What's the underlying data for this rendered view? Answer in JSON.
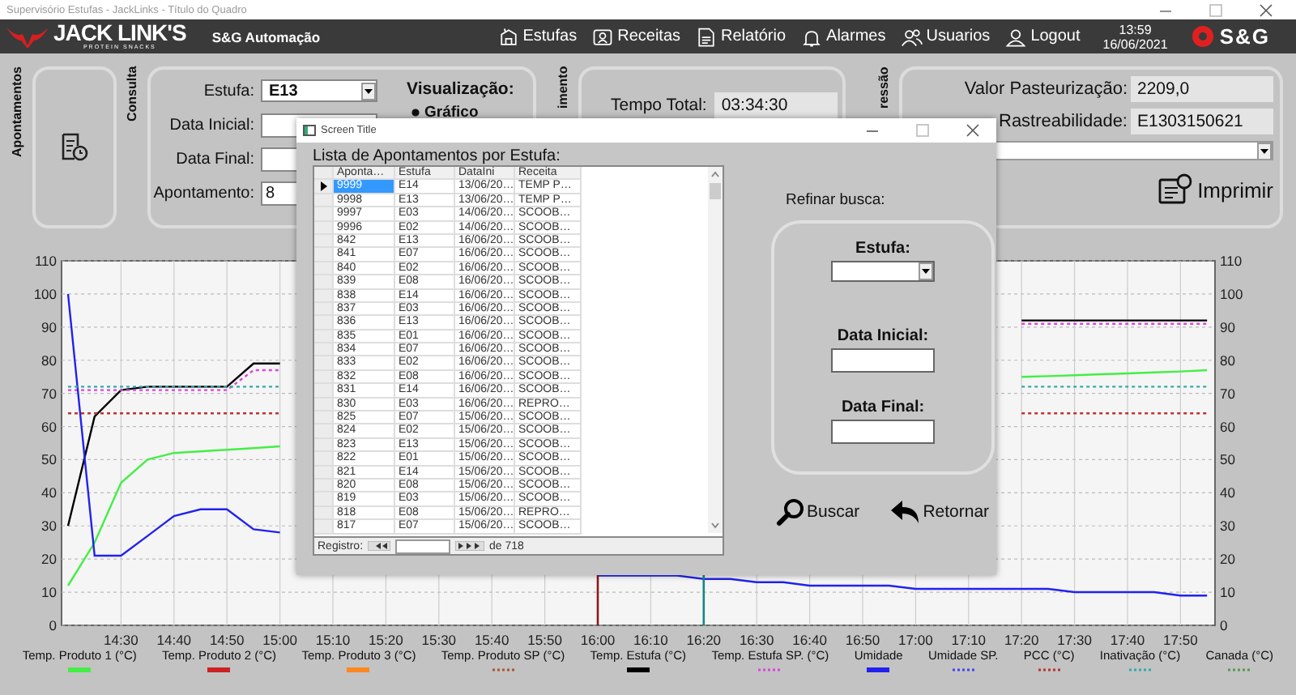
{
  "window": {
    "title": "Supervisório Estufas - JackLinks - Título do Quadro"
  },
  "header": {
    "brand": "JACK LINK'S",
    "brand_tagline": "PROTEIN SNACKS",
    "company": "S&G Automação",
    "nav": [
      {
        "label": "Estufas"
      },
      {
        "label": "Receitas"
      },
      {
        "label": "Relatório"
      },
      {
        "label": "Alarmes"
      },
      {
        "label": "Usuarios"
      },
      {
        "label": "Logout"
      }
    ],
    "time": "13:59",
    "date": "16/06/2021",
    "partner_logo": "S&G"
  },
  "panels": {
    "apontamentos": {
      "label": "Apontamentos"
    },
    "consulta": {
      "label": "Consulta",
      "estufa_label": "Estufa:",
      "estufa_value": "E13",
      "data_inicial_label": "Data Inicial:",
      "data_final_label": "Data Final:",
      "apontamento_label": "Apontamento:",
      "apontamento_value": "8",
      "visualizacao_label": "Visualização:",
      "visualizacao_option": {
        "label": "Gráfico",
        "selected": true
      }
    },
    "tempo": {
      "label": "imento",
      "tempo_total_label": "Tempo Total:",
      "tempo_total_value": "03:34:30"
    },
    "impressao": {
      "label": "ressão",
      "valor_label": "Valor Pasteurização:",
      "valor_value": "2209,0",
      "rastreabilidade_label": "Rastreabilidade:",
      "rastreabilidade_value": "E1303150621",
      "print_button": "Imprimir"
    }
  },
  "chart": {
    "chart_data": {
      "type": "line",
      "ylim": [
        0,
        110
      ],
      "categories": [
        null,
        null,
        "14:30",
        null,
        "14:40",
        null,
        "14:50",
        null,
        "15:00",
        null,
        "15:10",
        null,
        "15:20",
        null,
        "15:30",
        null,
        "15:40",
        null,
        "15:50",
        null,
        "16:00",
        null,
        "16:10",
        null,
        "16:20",
        null,
        "16:30",
        null,
        "16:40",
        null,
        "16:50",
        null,
        "17:00",
        null,
        "17:10",
        null,
        "17:20",
        null,
        "17:30",
        null,
        "17:40",
        null,
        "17:50",
        null
      ],
      "yticks": [
        0,
        10,
        20,
        30,
        40,
        50,
        60,
        70,
        80,
        90,
        100,
        110
      ],
      "series": [
        {
          "name": "Temp. Produto 1 (°C)",
          "color": "#44ee44",
          "line_style": "solid",
          "values": [
            12,
            25,
            43,
            50,
            52,
            52.5,
            53,
            53.5,
            54,
            null,
            null,
            null,
            null,
            null,
            null,
            null,
            null,
            null,
            null,
            null,
            null,
            null,
            null,
            null,
            null,
            null,
            null,
            null,
            null,
            null,
            null,
            null,
            null,
            null,
            null,
            null,
            75,
            75.2,
            75.5,
            75.8,
            76,
            76.3,
            76.6,
            77
          ]
        },
        {
          "name": "Temp. Produto 2 (°C)",
          "color": "#cc2222",
          "line_style": "solid",
          "values": [
            null,
            null,
            null,
            null,
            null,
            null,
            null,
            null,
            null,
            null,
            null,
            null,
            null,
            null,
            null,
            null,
            null,
            null,
            null,
            null,
            null,
            null,
            null,
            null,
            null,
            null,
            null,
            null,
            null,
            null,
            null,
            null,
            null,
            null,
            null,
            null,
            null,
            null,
            null,
            null,
            null,
            null,
            null,
            null
          ]
        },
        {
          "name": "Temp. Produto 3 (°C)",
          "color": "#ff8822",
          "line_style": "solid",
          "values": [
            null,
            null,
            null,
            null,
            null,
            null,
            null,
            null,
            null,
            null,
            null,
            null,
            null,
            null,
            null,
            null,
            null,
            null,
            null,
            null,
            null,
            null,
            null,
            null,
            null,
            null,
            null,
            null,
            null,
            null,
            null,
            null,
            null,
            null,
            null,
            null,
            null,
            null,
            null,
            null,
            null,
            null,
            null,
            null
          ]
        },
        {
          "name": "Temp. Produto SP (°C)",
          "color": "#aa5533",
          "line_style": "dotted",
          "values": [
            null,
            null,
            null,
            null,
            null,
            null,
            null,
            null,
            null,
            null,
            null,
            null,
            null,
            null,
            null,
            null,
            null,
            null,
            null,
            null,
            null,
            null,
            null,
            null,
            null,
            null,
            null,
            null,
            null,
            null,
            null,
            null,
            null,
            null,
            null,
            null,
            null,
            null,
            null,
            null,
            null,
            null,
            null,
            null
          ]
        },
        {
          "name": "Temp. Estufa (°C)",
          "color": "#000000",
          "line_style": "solid",
          "values": [
            30,
            63,
            71,
            72,
            72,
            72,
            72,
            79,
            79,
            null,
            null,
            null,
            null,
            null,
            null,
            null,
            null,
            null,
            null,
            null,
            null,
            null,
            null,
            null,
            null,
            null,
            null,
            null,
            null,
            null,
            null,
            null,
            null,
            null,
            null,
            null,
            92,
            92,
            92,
            92,
            92,
            92,
            92,
            92
          ]
        },
        {
          "name": "Temp. Estufa SP. (°C)",
          "color": "#dd44dd",
          "line_style": "dotted",
          "values": [
            71,
            71,
            71,
            71,
            71,
            71,
            71,
            77,
            77,
            null,
            null,
            null,
            null,
            null,
            null,
            null,
            null,
            null,
            null,
            null,
            null,
            null,
            null,
            null,
            null,
            null,
            null,
            null,
            null,
            null,
            null,
            null,
            null,
            null,
            null,
            null,
            91,
            91,
            91,
            91,
            91,
            91,
            91,
            91
          ]
        },
        {
          "name": "Umidade",
          "color": "#2222ee",
          "line_style": "solid",
          "values": [
            100,
            21,
            21,
            27,
            33,
            35,
            35,
            29,
            28,
            null,
            null,
            null,
            null,
            null,
            null,
            null,
            null,
            null,
            null,
            null,
            15,
            15,
            15,
            15,
            14,
            14,
            13,
            13,
            12,
            12,
            12,
            12,
            11,
            11,
            11,
            11,
            11,
            11,
            10,
            10,
            10,
            10,
            9,
            9
          ]
        },
        {
          "name": "Umidade SP.",
          "color": "#4444ee",
          "line_style": "dotted",
          "values": [
            null,
            null,
            null,
            null,
            null,
            null,
            null,
            null,
            null,
            null,
            null,
            null,
            null,
            null,
            null,
            null,
            null,
            null,
            null,
            null,
            null,
            null,
            null,
            null,
            null,
            null,
            null,
            null,
            null,
            null,
            null,
            null,
            null,
            null,
            null,
            null,
            null,
            null,
            null,
            null,
            null,
            null,
            null,
            null
          ]
        },
        {
          "name": "PCC (°C)",
          "color": "#bb3333",
          "line_style": "dotted",
          "values": [
            64,
            64,
            64,
            64,
            64,
            64,
            64,
            64,
            64,
            null,
            null,
            null,
            null,
            null,
            null,
            null,
            null,
            null,
            null,
            null,
            null,
            null,
            null,
            null,
            null,
            null,
            null,
            null,
            null,
            null,
            null,
            null,
            null,
            null,
            null,
            null,
            64,
            64,
            64,
            64,
            64,
            64,
            64,
            64
          ]
        },
        {
          "name": "Inativação (°C)",
          "color": "#33aaaa",
          "line_style": "dotted",
          "values": [
            72,
            72,
            72,
            72,
            72,
            72,
            72,
            72,
            72,
            null,
            null,
            null,
            null,
            null,
            null,
            null,
            null,
            null,
            null,
            null,
            null,
            null,
            null,
            null,
            null,
            null,
            null,
            null,
            null,
            null,
            null,
            null,
            null,
            null,
            null,
            null,
            72,
            72,
            72,
            72,
            72,
            72,
            72,
            72
          ]
        },
        {
          "name": "Canada (°C)",
          "color": "#559955",
          "line_style": "dotted",
          "values": [
            null,
            null,
            null,
            null,
            null,
            null,
            null,
            null,
            null,
            null,
            null,
            null,
            null,
            null,
            null,
            null,
            null,
            null,
            null,
            null,
            null,
            null,
            null,
            null,
            null,
            null,
            null,
            null,
            null,
            null,
            null,
            null,
            null,
            null,
            null,
            null,
            null,
            null,
            null,
            null,
            null,
            null,
            null,
            null
          ]
        }
      ],
      "grid": true,
      "ref_lines": [
        {
          "axis": "x",
          "value": "16:00",
          "color": "#8b1a1a"
        },
        {
          "axis": "x",
          "value": "16:20",
          "color": "#118888"
        }
      ]
    },
    "right_axis_labels": [
      "110",
      "100",
      "90",
      "80",
      "70",
      "60",
      "50",
      "40",
      "30",
      "20",
      "10",
      "0"
    ]
  },
  "dialog": {
    "title": "Screen Title",
    "heading": "Lista de Apontamentos por Estufa:",
    "columns": [
      "Aponta…",
      "Estufa",
      "DataIni",
      "Receita"
    ],
    "rows": [
      {
        "cells": [
          "9999",
          "E14",
          "13/06/20…",
          "TEMP P…"
        ],
        "selected": true
      },
      {
        "cells": [
          "9998",
          "E13",
          "13/06/20…",
          "TEMP P…"
        ],
        "selected": false
      },
      {
        "cells": [
          "9997",
          "E03",
          "14/06/20…",
          "SCOOB…"
        ],
        "selected": false
      },
      {
        "cells": [
          "9996",
          "E02",
          "14/06/20…",
          "SCOOB…"
        ],
        "selected": false
      },
      {
        "cells": [
          "842",
          "E13",
          "16/06/20…",
          "SCOOB…"
        ],
        "selected": false
      },
      {
        "cells": [
          "841",
          "E07",
          "16/06/20…",
          "SCOOB…"
        ],
        "selected": false
      },
      {
        "cells": [
          "840",
          "E02",
          "16/06/20…",
          "SCOOB…"
        ],
        "selected": false
      },
      {
        "cells": [
          "839",
          "E08",
          "16/06/20…",
          "SCOOB…"
        ],
        "selected": false
      },
      {
        "cells": [
          "838",
          "E14",
          "16/06/20…",
          "SCOOB…"
        ],
        "selected": false
      },
      {
        "cells": [
          "837",
          "E03",
          "16/06/20…",
          "SCOOB…"
        ],
        "selected": false
      },
      {
        "cells": [
          "836",
          "E13",
          "16/06/20…",
          "SCOOB…"
        ],
        "selected": false
      },
      {
        "cells": [
          "835",
          "E01",
          "16/06/20…",
          "SCOOB…"
        ],
        "selected": false
      },
      {
        "cells": [
          "834",
          "E07",
          "16/06/20…",
          "SCOOB…"
        ],
        "selected": false
      },
      {
        "cells": [
          "833",
          "E02",
          "16/06/20…",
          "SCOOB…"
        ],
        "selected": false
      },
      {
        "cells": [
          "832",
          "E08",
          "16/06/20…",
          "SCOOB…"
        ],
        "selected": false
      },
      {
        "cells": [
          "831",
          "E14",
          "16/06/20…",
          "SCOOB…"
        ],
        "selected": false
      },
      {
        "cells": [
          "830",
          "E03",
          "16/06/20…",
          "REPRO…"
        ],
        "selected": false
      },
      {
        "cells": [
          "825",
          "E07",
          "15/06/20…",
          "SCOOB…"
        ],
        "selected": false
      },
      {
        "cells": [
          "824",
          "E02",
          "15/06/20…",
          "SCOOB…"
        ],
        "selected": false
      },
      {
        "cells": [
          "823",
          "E13",
          "15/06/20…",
          "SCOOB…"
        ],
        "selected": false
      },
      {
        "cells": [
          "822",
          "E01",
          "15/06/20…",
          "SCOOB…"
        ],
        "selected": false
      },
      {
        "cells": [
          "821",
          "E14",
          "15/06/20…",
          "SCOOB…"
        ],
        "selected": false
      },
      {
        "cells": [
          "820",
          "E08",
          "15/06/20…",
          "SCOOB…"
        ],
        "selected": false
      },
      {
        "cells": [
          "819",
          "E03",
          "15/06/20…",
          "SCOOB…"
        ],
        "selected": false
      },
      {
        "cells": [
          "818",
          "E08",
          "15/06/20…",
          "REPRO…"
        ],
        "selected": false
      },
      {
        "cells": [
          "817",
          "E07",
          "15/06/20…",
          "SCOOB…"
        ],
        "selected": false
      }
    ],
    "record_label": "Registro:",
    "record_count": "de 718",
    "refine_label": "Refinar busca:",
    "estufa_label": "Estufa:",
    "data_inicial_label": "Data Inicial:",
    "data_final_label": "Data Final:",
    "buttons": [
      {
        "label": "Buscar"
      },
      {
        "label": "Retornar"
      }
    ]
  }
}
